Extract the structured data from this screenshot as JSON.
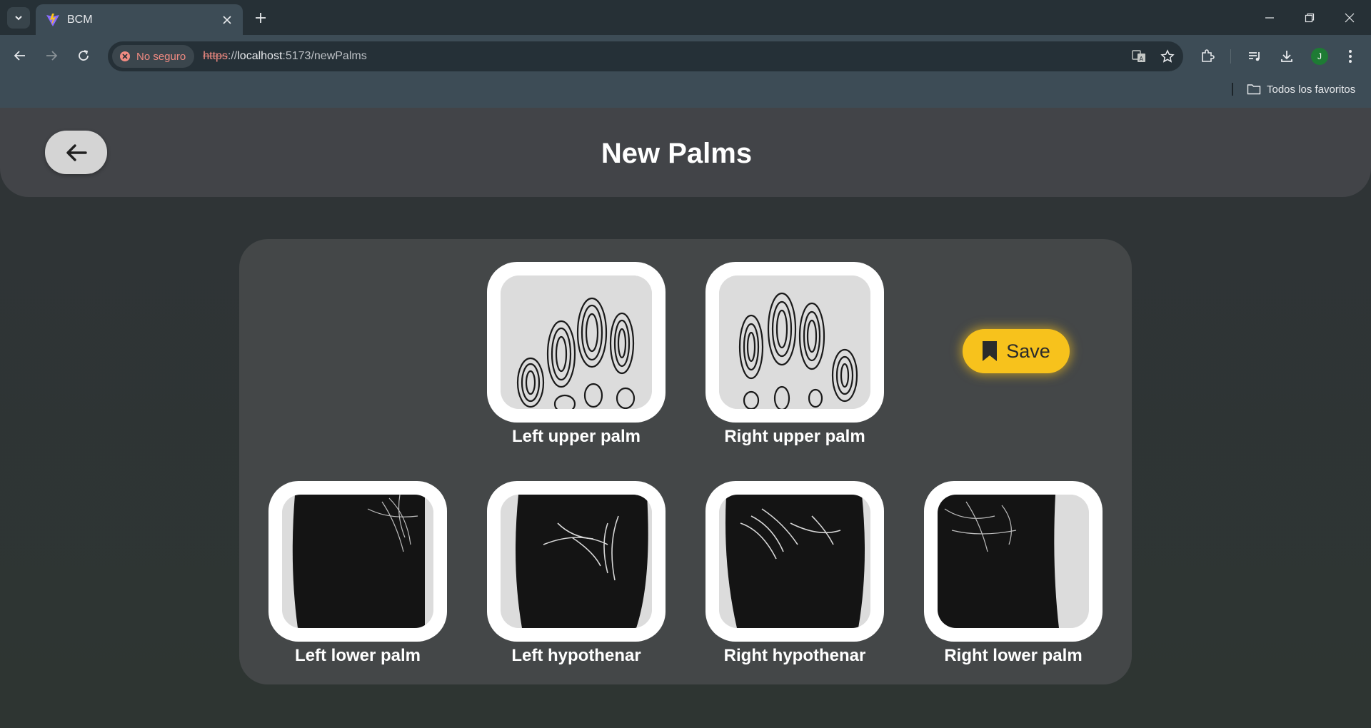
{
  "browser": {
    "tab_title": "BCM",
    "security_label": "No seguro",
    "url_scheme": "https",
    "url_sep": "://",
    "url_host": "localhost",
    "url_rest": ":5173/newPalms",
    "bookmarks_folder": "Todos los favoritos",
    "profile_initial": "J"
  },
  "header": {
    "title": "New Palms"
  },
  "palms": {
    "left_upper": "Left upper palm",
    "right_upper": "Right upper palm",
    "left_lower": "Left lower palm",
    "left_hypothenar": "Left hypothenar",
    "right_hypothenar": "Right hypothenar",
    "right_lower": "Right lower palm"
  },
  "actions": {
    "save_label": "Save"
  },
  "colors": {
    "accent": "#f7c21c",
    "header_bg": "#424448",
    "panel_bg": "#444748"
  }
}
